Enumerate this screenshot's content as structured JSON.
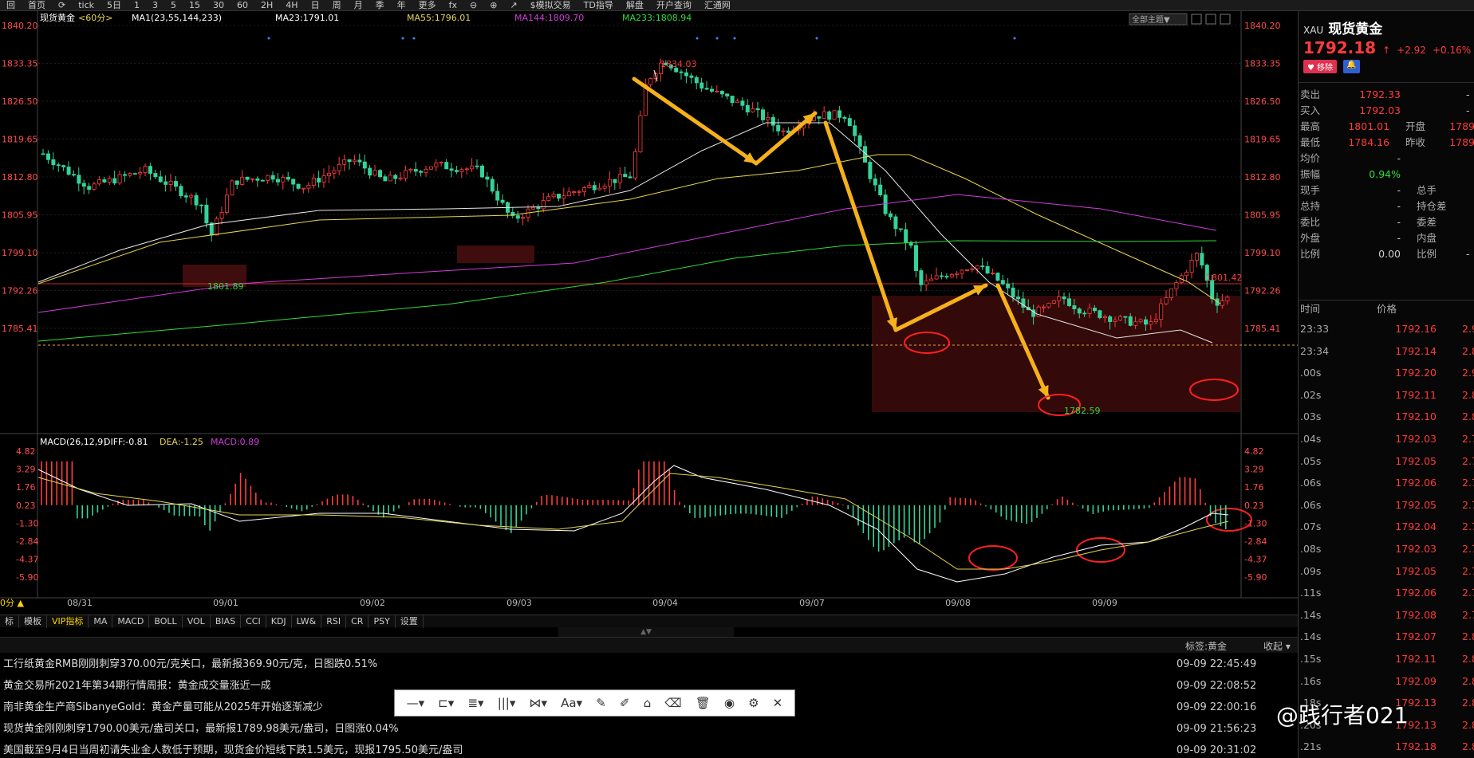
{
  "toolbar": {
    "items": [
      "回",
      "首页",
      "⟳",
      "tick",
      "5日",
      "1",
      "3",
      "5",
      "15",
      "30",
      "60",
      "2H",
      "4H",
      "日",
      "周",
      "月",
      "季",
      "年",
      "更多",
      "fx",
      "⊖",
      "⊕",
      "↗",
      "$模拟交易",
      "TD指导",
      "解盘",
      "开户查询",
      "汇通网"
    ]
  },
  "chart": {
    "title": "现货黄金",
    "period": "<60分>",
    "ma_legend": [
      {
        "text": "MA1(23,55,144,233)",
        "color": "#ffffff"
      },
      {
        "text": "MA23:1791.01",
        "color": "#ffffff"
      },
      {
        "text": "MA55:1796.01",
        "color": "#e8d54f"
      },
      {
        "text": "MA144:1809.70",
        "color": "#d23cdc"
      },
      {
        "text": "MA233:1808.94",
        "color": "#2fdc3a"
      }
    ],
    "theme_btn": "全部主题▼",
    "y_ticks": [
      "1840.20",
      "1833.35",
      "1826.50",
      "1819.65",
      "1812.80",
      "1805.95",
      "1799.10",
      "1792.26",
      "1785.41"
    ],
    "right_ticks": [
      "1840.20",
      "1833.35",
      "1826.50",
      "1819.65",
      "1812.80",
      "1805.95",
      "1799.10",
      "1792.26",
      "1785.41"
    ],
    "annotations": {
      "high": "1834.03",
      "low_left": "1801.89",
      "low_right": "1782.59",
      "right_high": "1801.42"
    },
    "macd_legend": [
      {
        "text": "MACD(26,12,9)",
        "color": "#ffffff"
      },
      {
        "text": "DIFF:-0.81",
        "color": "#ffffff"
      },
      {
        "text": "DEA:-1.25",
        "color": "#e8d54f"
      },
      {
        "text": "MACD:0.89",
        "color": "#d23cdc"
      }
    ],
    "macd_ticks": [
      "4.82",
      "3.29",
      "1.76",
      "0.23",
      "-1.30",
      "-2.84",
      "-4.37",
      "-5.90"
    ],
    "dates": [
      "08/31",
      "09/01",
      "09/02",
      "09/03",
      "09/04",
      "09/07",
      "09/08",
      "09/09"
    ],
    "period_label": "0分 ▲"
  },
  "indicators": [
    "标",
    "模板",
    "VIP指标",
    "MA",
    "MACD",
    "BOLL",
    "VOL",
    "BIAS",
    "CCI",
    "KDJ",
    "LW&",
    "RSI",
    "CR",
    "PSY",
    "设置"
  ],
  "sidebar": {
    "code": "XAU",
    "name": "现货黄金",
    "price": "1792.18",
    "arrow": "↑",
    "change": "+2.92",
    "pct": "+0.16%",
    "remove_btn": "移除",
    "quote_rows": [
      {
        "l": "卖出",
        "v": "1792.33",
        "l2": "",
        "v2": "-"
      },
      {
        "l": "买入",
        "v": "1792.03",
        "l2": "",
        "v2": "-"
      },
      {
        "l": "最高",
        "v": "1801.01",
        "l2": "开盘",
        "v2": "1789"
      },
      {
        "l": "最低",
        "v": "1784.16",
        "l2": "昨收",
        "v2": "1789"
      },
      {
        "l": "均价",
        "v": "-",
        "l2": "",
        "v2": ""
      },
      {
        "l": "振幅",
        "v": "0.94%",
        "l2": "",
        "v2": ""
      },
      {
        "l": "现手",
        "v": "-",
        "l2": "总手",
        "v2": ""
      },
      {
        "l": "总持",
        "v": "-",
        "l2": "持仓差",
        "v2": ""
      },
      {
        "l": "委比",
        "v": "-",
        "l2": "委差",
        "v2": ""
      },
      {
        "l": "外盘",
        "v": "-",
        "l2": "内盘",
        "v2": ""
      },
      {
        "l": "比例",
        "v": "0.00",
        "l2": "比例",
        "v2": "-"
      }
    ],
    "tick_header": {
      "time": "时间",
      "price": "价格"
    },
    "ticks": [
      {
        "t": "23:33",
        "p": "1792.16",
        "v": "2.9"
      },
      {
        "t": "23:34",
        "p": "1792.14",
        "v": "2.8"
      },
      {
        "t": ".00s",
        "p": "1792.20",
        "v": "2.9"
      },
      {
        "t": ".02s",
        "p": "1792.11",
        "v": "2.8"
      },
      {
        "t": ".03s",
        "p": "1792.10",
        "v": "2.8"
      },
      {
        "t": ".04s",
        "p": "1792.03",
        "v": "2.7"
      },
      {
        "t": ".05s",
        "p": "1792.05",
        "v": "2.7"
      },
      {
        "t": ".06s",
        "p": "1792.06",
        "v": "2.7"
      },
      {
        "t": ".06s",
        "p": "1792.05",
        "v": "2.7"
      },
      {
        "t": ".07s",
        "p": "1792.04",
        "v": "2.7"
      },
      {
        "t": ".08s",
        "p": "1792.03",
        "v": "2.7"
      },
      {
        "t": ".09s",
        "p": "1792.05",
        "v": "2.7"
      },
      {
        "t": ".11s",
        "p": "1792.06",
        "v": "2.7"
      },
      {
        "t": ".14s",
        "p": "1792.08",
        "v": "2.7"
      },
      {
        "t": ".14s",
        "p": "1792.07",
        "v": "2.8"
      },
      {
        "t": ".15s",
        "p": "1792.11",
        "v": "2.8"
      },
      {
        "t": ".16s",
        "p": "1792.09",
        "v": "2.8"
      },
      {
        "t": ".18s",
        "p": "1792.13",
        "v": "2.8"
      },
      {
        "t": ".20s",
        "p": "1792.13",
        "v": "2.8"
      },
      {
        "t": ".21s",
        "p": "1792.18",
        "v": "2.8"
      }
    ]
  },
  "news": {
    "label": "标签:黄金",
    "fold": "收起 ▾",
    "items": [
      {
        "text": "工行纸黄金RMB刚刚刺穿370.00元/克关口，最新报369.90元/克，日图跌0.51%",
        "date": "09-09 22:45:49"
      },
      {
        "text": "黄金交易所2021年第34期行情周报：黄金成交量涨近一成",
        "date": "09-09 22:08:52"
      },
      {
        "text": "南非黄金生产商SibanyeGold：黄金产量可能从2025年开始逐渐减少",
        "date": "09-09 22:00:16"
      },
      {
        "text": "现货黄金刚刚刺穿1790.00美元/盎司关口，最新报1789.98美元/盎司，日图涨0.04%",
        "date": "09-09 21:56:23"
      },
      {
        "text": "美国截至9月4日当周初请失业金人数低于预期，现货金价短线下跌1.5美元，现报1795.50美元/盎司",
        "date": "09-09 20:31:02"
      }
    ]
  },
  "drawbar": {
    "tools": [
      "—▾",
      "⊏▾",
      "≣▾",
      "|||▾",
      "⋈▾",
      "Aa▾",
      "✎",
      "✐",
      "⌂",
      "⌫",
      "🗑",
      "◉",
      "⚙",
      "✕"
    ]
  },
  "watermark": "@践行者021"
}
